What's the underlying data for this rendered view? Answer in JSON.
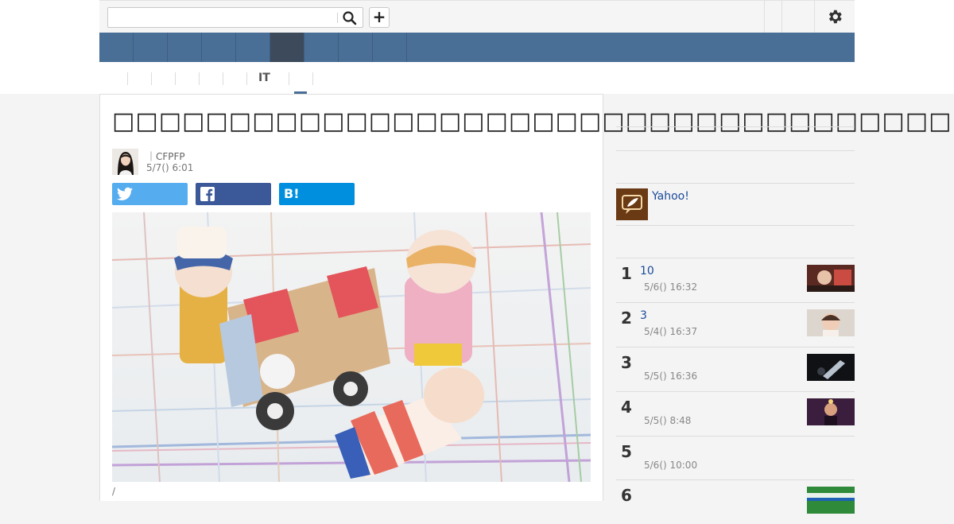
{
  "header": {
    "search_value": "",
    "plus_label": "+"
  },
  "nav": {
    "items": [
      "",
      "",
      "",
      "",
      "",
      "",
      "",
      "",
      ""
    ],
    "active_index": 5
  },
  "subnav": {
    "items": [
      "",
      "",
      "",
      "",
      "",
      "IT",
      ""
    ],
    "active_index": 5
  },
  "article": {
    "title": "□□□□□□□□□□□□□□□□□□□□□□□□□□□□□□□□□□□□□□",
    "author": "｜CFPFP",
    "date": "5/7() 6:01",
    "share_hatena": "B!",
    "caption": "/"
  },
  "sidebar": {
    "promo_text": "Yahoo!",
    "ranking": [
      {
        "num": "1",
        "title": "10",
        "date": "5/6() 16:32"
      },
      {
        "num": "2",
        "title": "3",
        "date": "5/4() 16:37"
      },
      {
        "num": "3",
        "title": "",
        "date": "5/5() 16:36"
      },
      {
        "num": "4",
        "title": "",
        "date": "5/5() 8:48"
      },
      {
        "num": "5",
        "title": "",
        "date": "5/6() 10:00"
      },
      {
        "num": "6",
        "title": "",
        "date": ""
      }
    ]
  },
  "colors": {
    "nav_blue": "#4a6f96",
    "nav_active": "#3d4a5b",
    "twitter": "#55acee",
    "facebook": "#3b5998",
    "hatena": "#008fde",
    "link": "#1a4a9a"
  }
}
